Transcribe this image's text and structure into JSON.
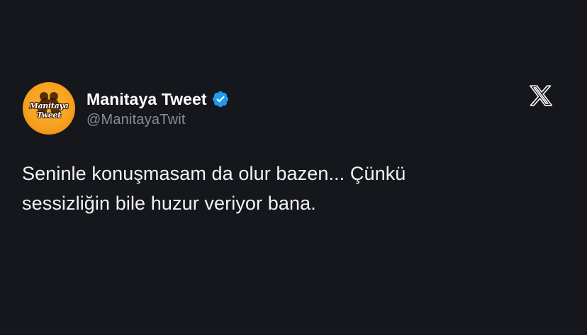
{
  "tweet": {
    "author": {
      "display_name": "Manitaya Tweet",
      "handle": "@ManitayaTwit",
      "verified": true,
      "avatar": {
        "icon": "couple-silhouette-logo",
        "logo_text_line1": "Manitaya",
        "logo_text_line2": "Tweet",
        "background_color": "#f6a21f"
      }
    },
    "text_lines": [
      "Seninle konuşmasam da olur bazen... Çünkü",
      "sessizliğin bile huzur veriyor bana."
    ],
    "platform_icon": "x-logo-icon",
    "verified_badge_color": "#1d9bf0"
  },
  "theme": {
    "background": "#16171c",
    "text_primary": "#ffffff",
    "text_secondary": "#8b8d93"
  }
}
